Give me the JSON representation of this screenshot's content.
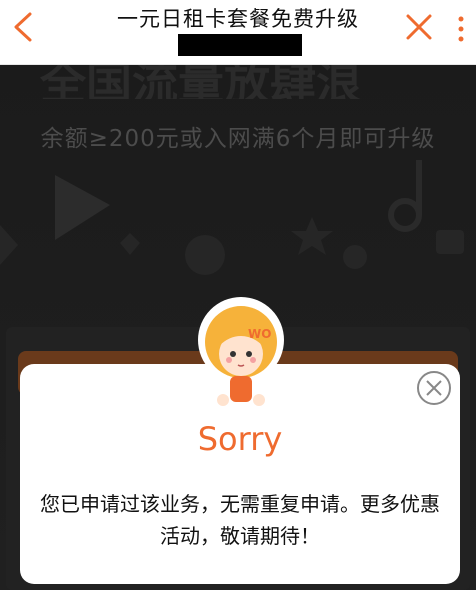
{
  "header": {
    "title": "一元日租卡套餐免费升级",
    "back_icon": "chevron-left-icon",
    "close_icon": "close-icon",
    "more_icon": "more-vertical-icon",
    "accent_color": "#ef6b2f"
  },
  "background": {
    "headline": "全国流量放肆浪",
    "subtext": "余额≥200元或入网满6个月即可升级"
  },
  "dialog": {
    "title": "Sorry",
    "message": "您已申请过该业务，无需重复申请。更多优惠活动，敬请期待！",
    "close_icon": "circle-close-icon",
    "mascot": "wo-mascot-girl"
  }
}
